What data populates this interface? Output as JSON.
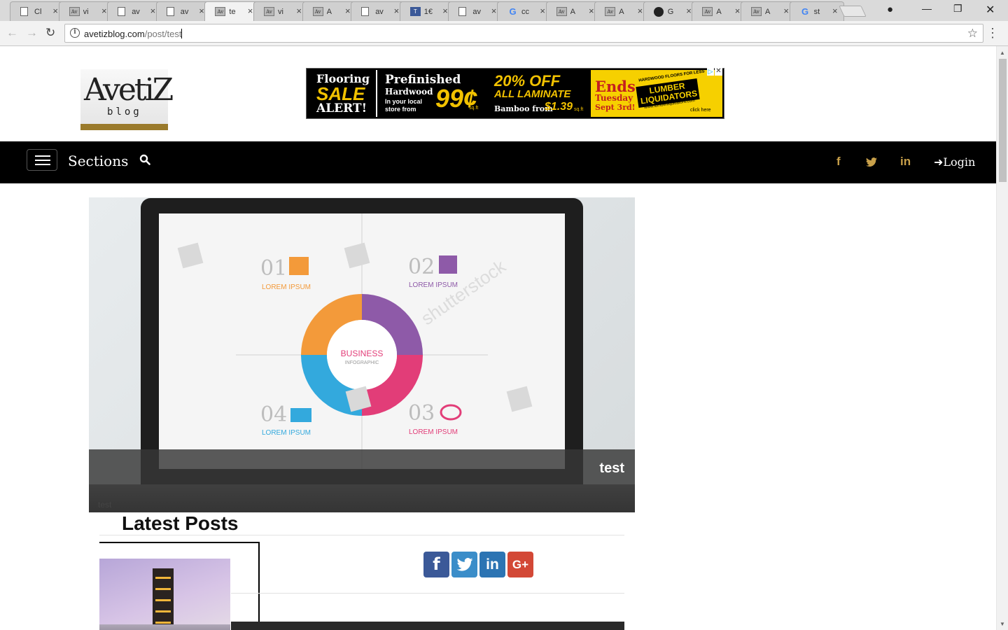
{
  "browser": {
    "tabs": [
      {
        "title": "Cl",
        "favicon": "doc"
      },
      {
        "title": "vi",
        "favicon": "avetiz"
      },
      {
        "title": "av",
        "favicon": "doc"
      },
      {
        "title": "av",
        "favicon": "doc"
      },
      {
        "title": "te",
        "favicon": "avetiz",
        "active": true
      },
      {
        "title": "vi",
        "favicon": "avetiz"
      },
      {
        "title": "A",
        "favicon": "avetiz"
      },
      {
        "title": "av",
        "favicon": "doc"
      },
      {
        "title": "1€",
        "favicon": "translate"
      },
      {
        "title": "av",
        "favicon": "doc"
      },
      {
        "title": "cc",
        "favicon": "google"
      },
      {
        "title": "A",
        "favicon": "avetiz"
      },
      {
        "title": "A",
        "favicon": "avetiz"
      },
      {
        "title": "G",
        "favicon": "github"
      },
      {
        "title": "A",
        "favicon": "avetiz"
      },
      {
        "title": "A",
        "favicon": "avetiz"
      },
      {
        "title": "st",
        "favicon": "google"
      }
    ],
    "url_domain": "avetizblog.com",
    "url_path": "/post/test"
  },
  "site": {
    "logo_main": "AvetiZ",
    "logo_sub": "blog",
    "accent_color": "#c8a04a",
    "nav": {
      "sections_label": "Sections",
      "social": [
        "f",
        "t",
        "in"
      ],
      "login_label": "Login"
    }
  },
  "ad": {
    "seg1": [
      "Flooring",
      "SALE",
      "ALERT!"
    ],
    "seg2": {
      "title": "Prefinished",
      "sub": "Hardwood",
      "note": "In your local store from",
      "price": "99¢",
      "unit": "sq.ft"
    },
    "seg3": {
      "title": "20% OFF",
      "sub": "ALL LAMINATE",
      "note": "Bamboo from",
      "price": "$1.39",
      "unit": "sq.ft"
    },
    "seg4": {
      "ends": "Ends",
      "day": "Tuesday",
      "date": "Sept 3rd!",
      "tag": "HARDWOOD FLOORS FOR LESS",
      "brand": "LUMBER LIQUIDATORS",
      "site": "www.lumberliquidators.com",
      "cta": "click here"
    }
  },
  "hero": {
    "caption_title": "test",
    "caption_sub": "test",
    "infographic": {
      "center_title": "BUSINESS",
      "center_sub": "INFOGRAPHIC",
      "items": [
        {
          "num": "01",
          "label": "LOREM IPSUM",
          "color": "#f39a3a"
        },
        {
          "num": "02",
          "label": "LOREM IPSUM",
          "color": "#8e5aa8"
        },
        {
          "num": "03",
          "label": "LOREM IPSUM",
          "color": "#e23d78"
        },
        {
          "num": "04",
          "label": "LOREM IPSUM",
          "color": "#33a9dd"
        }
      ],
      "watermark": "shutterstock"
    }
  },
  "latest": {
    "heading": "Latest Posts",
    "share_buttons": [
      {
        "name": "facebook",
        "glyph": "f",
        "color": "#3b5998"
      },
      {
        "name": "twitter",
        "glyph": "t",
        "color": "#3a8dc9"
      },
      {
        "name": "linkedin",
        "glyph": "in",
        "color": "#2c74b3"
      },
      {
        "name": "googleplus",
        "glyph": "G+",
        "color": "#d34836"
      }
    ]
  }
}
